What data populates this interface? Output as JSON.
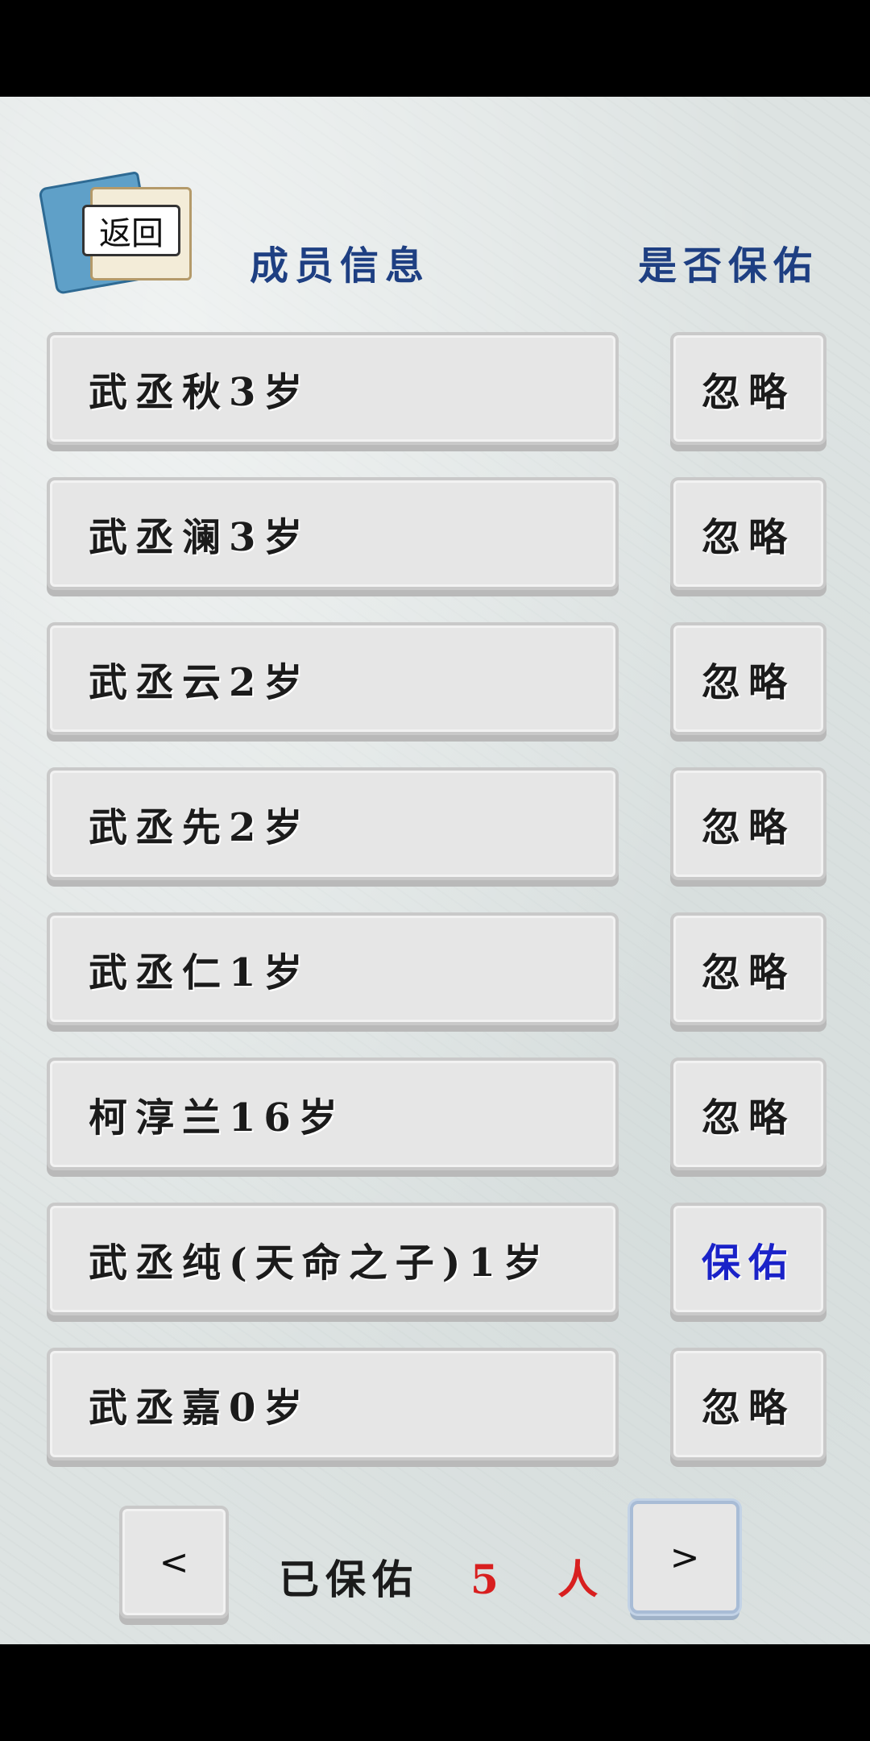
{
  "back": {
    "label": "返回"
  },
  "header": {
    "title": "成员信息",
    "status_title": "是否保佑"
  },
  "members": [
    {
      "name": "武丞秋3岁",
      "status": "忽略",
      "protected": false
    },
    {
      "name": "武丞澜3岁",
      "status": "忽略",
      "protected": false
    },
    {
      "name": "武丞云2岁",
      "status": "忽略",
      "protected": false
    },
    {
      "name": "武丞先2岁",
      "status": "忽略",
      "protected": false
    },
    {
      "name": "武丞仁1岁",
      "status": "忽略",
      "protected": false
    },
    {
      "name": "柯淳兰16岁",
      "status": "忽略",
      "protected": false
    },
    {
      "name": "武丞纯(天命之子)1岁",
      "status": "保佑",
      "protected": true
    },
    {
      "name": "武丞嘉0岁",
      "status": "忽略",
      "protected": false
    }
  ],
  "footer": {
    "prev_label": "<",
    "next_label": ">",
    "protected_label": "已保佑",
    "protected_count": "5 人"
  },
  "colors": {
    "header": "#1e3f82",
    "protected_status": "#1a22c8",
    "count": "#d81f1f"
  }
}
